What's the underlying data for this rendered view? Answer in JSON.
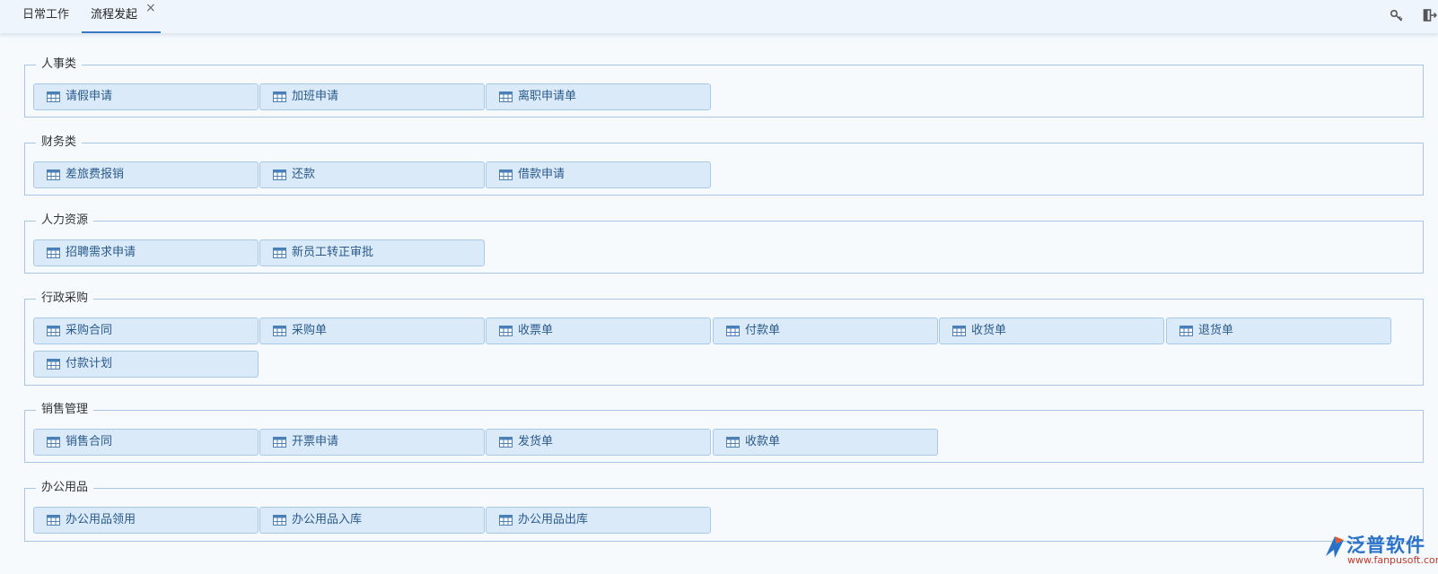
{
  "tabs": [
    {
      "label": "日常工作",
      "active": false
    },
    {
      "label": "流程发起",
      "active": true,
      "close": "×"
    }
  ],
  "header_icons": [
    "key-icon",
    "exit-icon"
  ],
  "groups": [
    {
      "title": "人事类",
      "items": [
        "请假申请",
        "加班申请",
        "离职申请单"
      ]
    },
    {
      "title": "财务类",
      "items": [
        "差旅费报销",
        "还款",
        "借款申请"
      ]
    },
    {
      "title": "人力资源",
      "items": [
        "招聘需求申请",
        "新员工转正审批"
      ]
    },
    {
      "title": "行政采购",
      "items": [
        "采购合同",
        "采购单",
        "收票单",
        "付款单",
        "收货单",
        "退货单",
        "付款计划"
      ]
    },
    {
      "title": "销售管理",
      "items": [
        "销售合同",
        "开票申请",
        "发货单",
        "收款单"
      ]
    },
    {
      "title": "办公用品",
      "items": [
        "办公用品领用",
        "办公用品入库",
        "办公用品出库"
      ]
    }
  ],
  "item_icon": "table-icon",
  "logo": {
    "name": "泛普软件",
    "url": "www.fanpusoft.com"
  },
  "colors": {
    "accent": "#3a78c3",
    "item_bg": "#dbeaf9",
    "border": "#a9c6e6",
    "logo": "#2a72c8",
    "logo_url": "#c0392b"
  }
}
